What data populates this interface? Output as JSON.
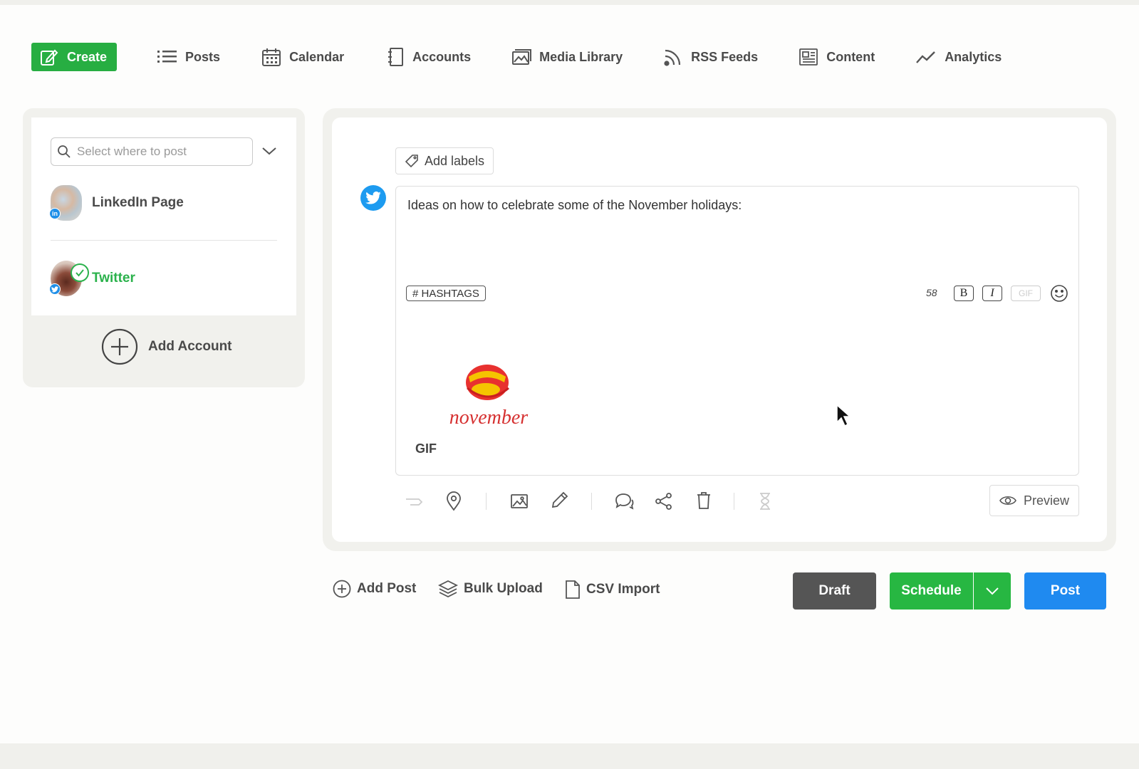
{
  "nav": {
    "create": "Create",
    "posts": "Posts",
    "calendar": "Calendar",
    "accounts": "Accounts",
    "media_library": "Media Library",
    "rss_feeds": "RSS Feeds",
    "content": "Content",
    "analytics": "Analytics"
  },
  "sidebar": {
    "search_placeholder": "Select where to post",
    "accounts": [
      {
        "label": "LinkedIn Page",
        "network": "linkedin",
        "selected": false
      },
      {
        "label": "Twitter",
        "network": "twitter",
        "selected": true
      }
    ],
    "add_account": "Add Account"
  },
  "editor": {
    "add_labels": "Add labels",
    "text": "Ideas on how to celebrate some of the November holidays:",
    "hashtags": "# HASHTAGS",
    "char_count": "58",
    "bold": "B",
    "italic": "I",
    "gif_button": "GIF",
    "media_caption": "GIF",
    "media_art_text": "november",
    "preview": "Preview"
  },
  "actions": {
    "add_post": "Add Post",
    "bulk_upload": "Bulk Upload",
    "csv_import": "CSV Import",
    "draft": "Draft",
    "schedule": "Schedule",
    "post": "Post"
  },
  "colors": {
    "green": "#27b742",
    "blue": "#1f8af0",
    "twitter": "#1d9bf0",
    "dark_button": "#555555"
  }
}
